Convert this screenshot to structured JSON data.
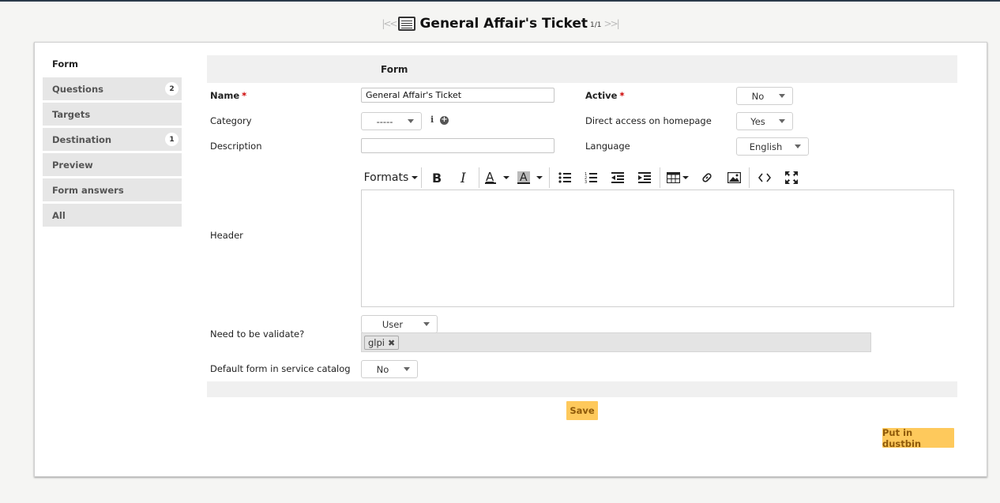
{
  "header": {
    "title": "General Affair's Ticket",
    "pager": "1/1",
    "first_arrow": "|<<",
    "last_arrow": ">>|"
  },
  "tabs": [
    {
      "label": "Form",
      "badge": null,
      "active": true
    },
    {
      "label": "Questions",
      "badge": "2"
    },
    {
      "label": "Targets",
      "badge": null
    },
    {
      "label": "Destination",
      "badge": "1"
    },
    {
      "label": "Preview",
      "badge": null
    },
    {
      "label": "Form answers",
      "badge": null
    },
    {
      "label": "All",
      "badge": null
    }
  ],
  "form": {
    "section_title": "Form",
    "name_label": "Name",
    "name_value": "General Affair's Ticket",
    "required_mark": "*",
    "active_label": "Active",
    "active_value": "No",
    "category_label": "Category",
    "category_value": "-----",
    "direct_access_label": "Direct access on homepage",
    "direct_access_value": "Yes",
    "description_label": "Description",
    "description_value": "",
    "language_label": "Language",
    "language_value": "English",
    "header_label": "Header",
    "editor_formats": "Formats",
    "validate_label": "Need to be validate?",
    "validate_value": "User",
    "validator_tag": "glpi",
    "default_form_label": "Default form in service catalog",
    "default_form_value": "No"
  },
  "buttons": {
    "save": "Save",
    "dustbin": "Put in dustbin"
  },
  "colors": {
    "button_bg": "#fec95c",
    "button_text": "#8f5a0a",
    "tab_bg": "#e6e6e6",
    "required": "#cc0000"
  }
}
